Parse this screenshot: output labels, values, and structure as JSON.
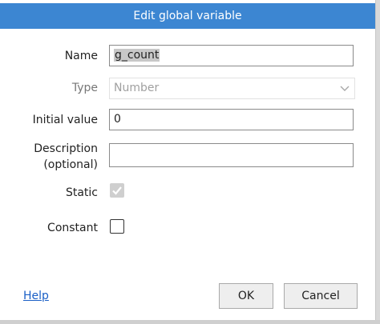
{
  "dialog": {
    "title": "Edit global variable"
  },
  "form": {
    "name_label": "Name",
    "name_value": "g_count",
    "type_label": "Type",
    "type_value": "Number",
    "initial_value_label": "Initial value",
    "initial_value_value": "0",
    "description_label_line1": "Description",
    "description_label_line2": "(optional)",
    "description_value": "",
    "static_label": "Static",
    "static_checked": true,
    "constant_label": "Constant",
    "constant_checked": false
  },
  "footer": {
    "help_label": "Help",
    "ok_label": "OK",
    "cancel_label": "Cancel"
  },
  "colors": {
    "titlebar": "#3c86d2",
    "link": "#1a5fc6"
  },
  "icons": {
    "type_dropdown": "chevron-down-icon",
    "static_check": "checkmark-icon"
  }
}
